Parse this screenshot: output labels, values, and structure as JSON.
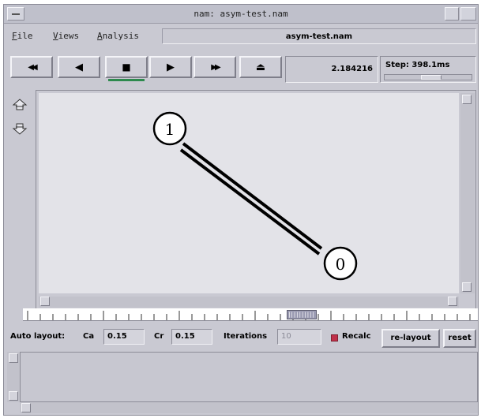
{
  "window": {
    "title": "nam: asym-test.nam",
    "file_name": "asym-test.nam"
  },
  "menu": {
    "items": [
      {
        "first": "F",
        "rest": "ile"
      },
      {
        "first": "V",
        "rest": "iews"
      },
      {
        "first": "A",
        "rest": "nalysis"
      }
    ]
  },
  "transport": {
    "rewind": "◀◀",
    "play_back": "◀",
    "stop": "■",
    "play_fwd": "▶",
    "fast_fwd": "▶▶",
    "eject": "⏏",
    "time": "2.184216",
    "step_label": "Step: 398.1ms",
    "step_position": 0.55
  },
  "network": {
    "nodes": [
      {
        "id": "1",
        "label": "1"
      },
      {
        "id": "0",
        "label": "0"
      }
    ]
  },
  "timeline": {
    "position": 0.62,
    "thumb_label": "||||||||||"
  },
  "autolayout": {
    "label": "Auto layout:",
    "ca_label": "Ca",
    "ca_value": "0.15",
    "cr_label": "Cr",
    "cr_value": "0.15",
    "iterations_label": "Iterations",
    "iterations_value": "10",
    "recalc_label": "Recalc",
    "relayout_label": "re-layout",
    "reset_label": "reset"
  },
  "colors": {
    "window_bg": "#c9c9d2",
    "canvas_bg": "#e3e3e8",
    "active_indicator": "#2e8a4e",
    "recalc_check": "#c0304a"
  }
}
